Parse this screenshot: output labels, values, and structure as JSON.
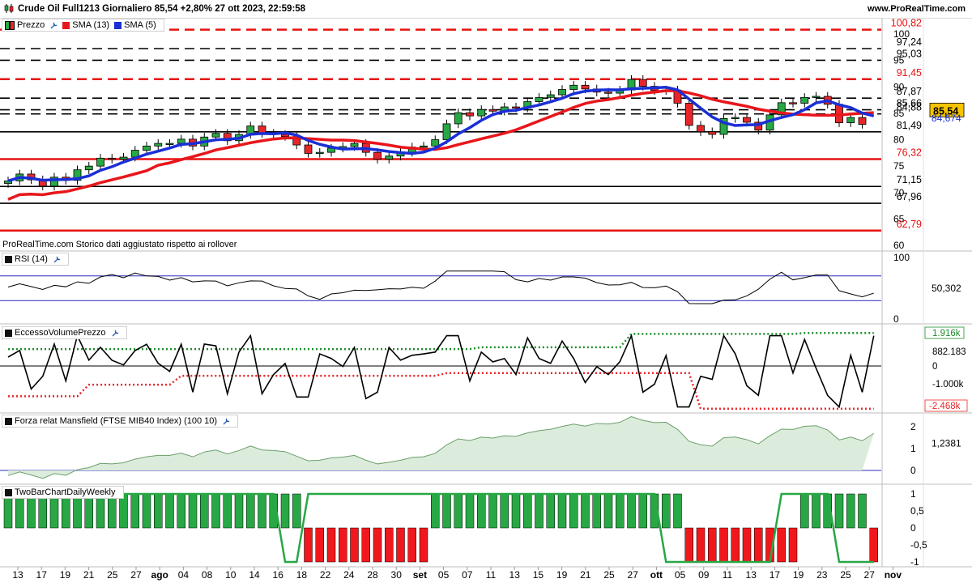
{
  "header": {
    "title": "Crude Oil Full1213 Giornaliero 85,54 +2,80% 27 ott 2023, 22:59:58",
    "site": "www.ProRealTime.com"
  },
  "price_panel": {
    "legend": [
      "Prezzo",
      "SMA (13)",
      "SMA (5)"
    ],
    "footnote": "ProRealTime.com  Storico dati aggiustato rispetto ai rollover",
    "last_price": "85,54",
    "sma5_value": "84,674",
    "y_ticks": [
      "100",
      "95",
      "90",
      "85",
      "80",
      "75",
      "70",
      "65",
      "60"
    ],
    "levels": [
      {
        "label": "100,82",
        "style": "red-dash"
      },
      {
        "label": "97,24",
        "style": "black-dash"
      },
      {
        "label": "95,03",
        "style": "black-dash"
      },
      {
        "label": "91,45",
        "style": "red-dash"
      },
      {
        "label": "87,87",
        "style": "black-dash"
      },
      {
        "label": "85,66",
        "style": "black-dash"
      },
      {
        "label": "84,88",
        "style": "black-dash"
      },
      {
        "label": "81,49",
        "style": "black-solid"
      },
      {
        "label": "76,32",
        "style": "red-solid"
      },
      {
        "label": "71,15",
        "style": "black-solid"
      },
      {
        "label": "67,96",
        "style": "black-solid"
      },
      {
        "label": "62,79",
        "style": "red-solid"
      }
    ]
  },
  "rsi_panel": {
    "legend": "RSI (14)",
    "value": "50,302",
    "y_ticks": [
      "100",
      "0"
    ]
  },
  "volume_panel": {
    "legend": "EccessoVolumePrezzo",
    "upper": "1.916k",
    "value": "882.183",
    "zero": "0",
    "tick": "-1.000k",
    "lower": "-2.468k"
  },
  "mansfield_panel": {
    "legend": "Forza relat Mansfield (FTSE MIB40 Index) (100 10)",
    "value": "1,2381",
    "y_ticks": [
      "2",
      "1",
      "0"
    ]
  },
  "twobar_panel": {
    "legend": "TwoBarChartDailyWeekly",
    "y_ticks": [
      "1",
      "0,5",
      "0",
      "-0,5",
      "-1"
    ]
  },
  "x_axis": [
    "13",
    "17",
    "19",
    "21",
    "25",
    "27",
    "ago",
    "04",
    "08",
    "10",
    "14",
    "16",
    "18",
    "22",
    "24",
    "28",
    "30",
    "set",
    "05",
    "07",
    "11",
    "13",
    "15",
    "19",
    "21",
    "25",
    "27",
    "ott",
    "05",
    "09",
    "11",
    "13",
    "17",
    "19",
    "23",
    "25",
    "27",
    "nov"
  ],
  "colors": {
    "up": "#27a844",
    "down": "#e8262a",
    "sma13": "#e8161b",
    "sma5": "#1a2fd6",
    "level_red": "#e81212"
  }
}
